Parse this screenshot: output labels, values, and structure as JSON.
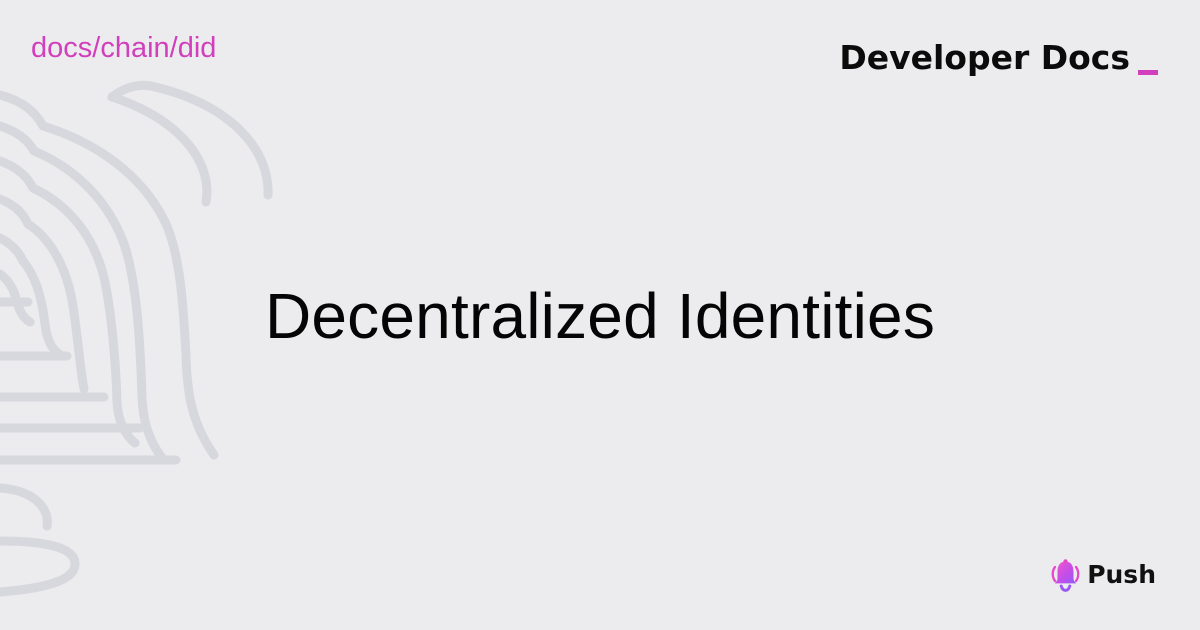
{
  "header": {
    "breadcrumb": "docs/chain/did",
    "brand_title": "Developer Docs"
  },
  "main": {
    "title": "Decentralized Identities"
  },
  "footer": {
    "logo_text": "Push"
  },
  "theme": {
    "background": "#ececee",
    "accent": "#d13fbd",
    "text": "#050505",
    "line_art": "#d7d7de"
  },
  "icons": {
    "background_art": "bell-line-art-icon",
    "brand_mark": "cursor-underscore-icon",
    "logo": "push-bell-icon"
  }
}
